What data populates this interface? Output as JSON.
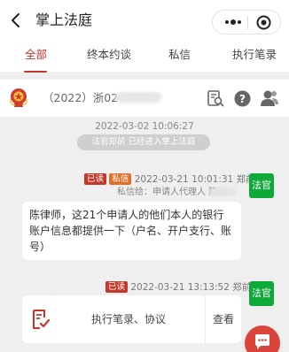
{
  "header": {
    "title": "掌上法庭"
  },
  "tabs": [
    {
      "label": "全部",
      "active": true
    },
    {
      "label": "终本约谈",
      "active": false
    },
    {
      "label": "私信",
      "active": false
    },
    {
      "label": "执行笔录",
      "active": false
    }
  ],
  "case": {
    "number": "（2022）浙02"
  },
  "messages": {
    "timestamp1": "2022-03-02 10:06:27",
    "system_notice": "法官郑前 已经进入掌上法庭",
    "msg1": {
      "read_badge": "已读",
      "private_badge": "私信",
      "time_sender": "2022-03-21 10:01:31 郑前",
      "to": "私信给：申请人代理人 陈",
      "avatar_label": "法官",
      "text": "陈律师，这21个申请人的他们本人的银行账户信息都提供一下（户名、开户支行、账号）"
    },
    "msg2": {
      "read_badge": "已读",
      "time_sender": "2022-03-21 13:13:52 郑前",
      "avatar_label": "法官",
      "card_title": "执行笔录、协议",
      "view_label": "查看"
    }
  },
  "colors": {
    "accent": "#c9332b",
    "judge_avatar": "#0fa93a",
    "private_badge": "#e0712d",
    "fab": "#d9453a"
  }
}
